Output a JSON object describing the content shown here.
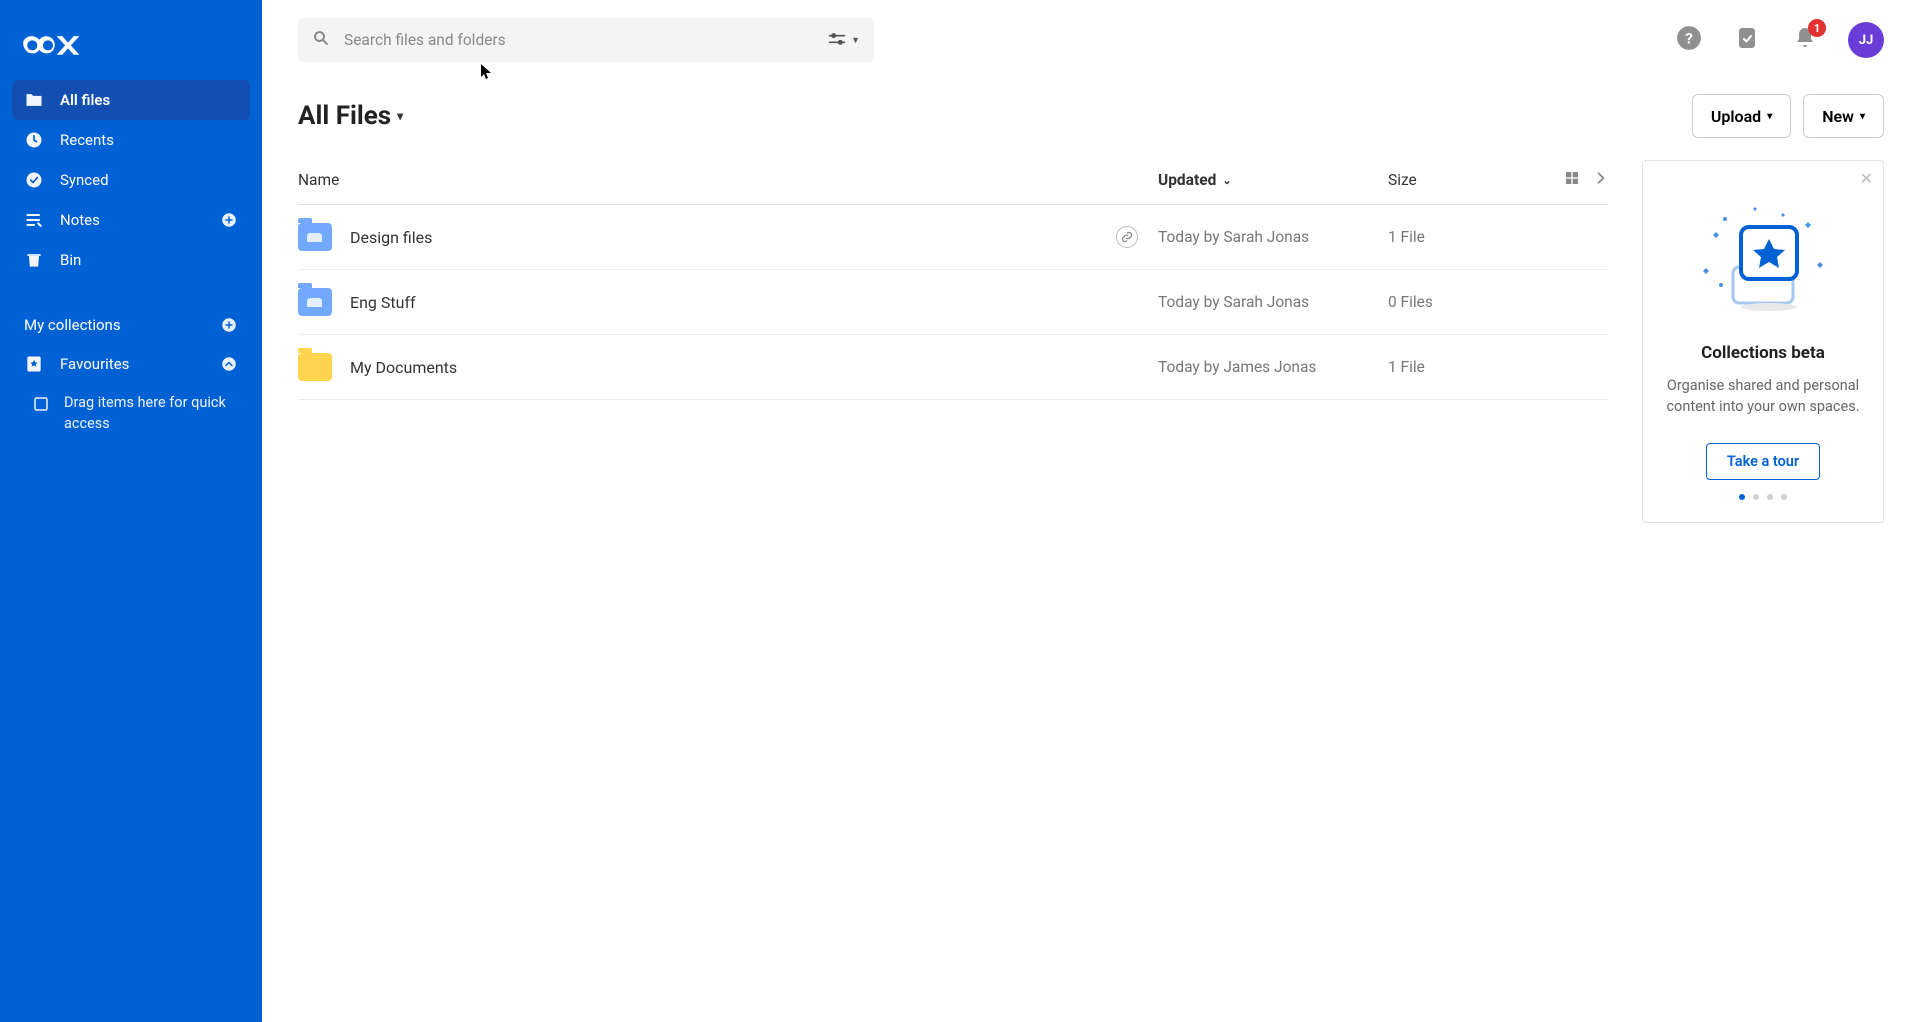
{
  "sidebar": {
    "items": [
      {
        "label": "All files"
      },
      {
        "label": "Recents"
      },
      {
        "label": "Synced"
      },
      {
        "label": "Notes"
      },
      {
        "label": "Bin"
      }
    ],
    "collections_header": "My collections",
    "favourites_label": "Favourites",
    "favourites_drop_hint": "Drag items here for quick access"
  },
  "topbar": {
    "search_placeholder": "Search files and folders",
    "notification_count": "1",
    "avatar_initials": "JJ"
  },
  "page": {
    "title": "All Files",
    "upload_label": "Upload",
    "new_label": "New"
  },
  "table": {
    "columns": {
      "name": "Name",
      "updated": "Updated",
      "size": "Size"
    },
    "rows": [
      {
        "name": "Design files",
        "updated": "Today by Sarah Jonas",
        "size": "1 File",
        "shared": true,
        "has_link": true
      },
      {
        "name": "Eng Stuff",
        "updated": "Today by Sarah Jonas",
        "size": "0 Files",
        "shared": true,
        "has_link": false
      },
      {
        "name": "My Documents",
        "updated": "Today by James Jonas",
        "size": "1 File",
        "shared": false,
        "has_link": false
      }
    ]
  },
  "promo": {
    "title": "Collections beta",
    "body": "Organise shared and personal content into your own spaces.",
    "cta": "Take a tour"
  }
}
